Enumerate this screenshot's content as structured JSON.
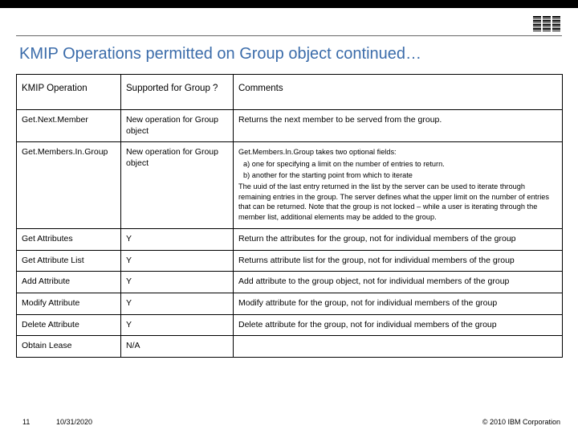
{
  "header": {
    "title": "KMIP Operations permitted on Group object continued…",
    "logo_alt": "IBM"
  },
  "table": {
    "headers": [
      "KMIP Operation",
      "Supported for Group ?",
      "Comments"
    ],
    "rows": [
      {
        "op": "Get.Next.Member",
        "sup": "New operation for Group object",
        "comment_plain": "Returns the next member to be served from the group."
      },
      {
        "op": "Get.Members.In.Group",
        "sup": "New operation for Group object",
        "comment_lines": [
          "Get.Members.In.Group takes two optional fields:",
          "a) one for specifying a limit on the number of entries to return.",
          "b) another for the starting point from which to iterate",
          "The uuid of the last entry returned in the list by the server can be used to iterate through remaining entries in the group.  The server defines what the upper limit on the number of entries that can be returned. Note that the group is not locked – while a user is iterating through the member list, additional elements may be added to the group."
        ]
      },
      {
        "op": "Get Attributes",
        "sup": "Y",
        "comment_plain": "Return the attributes for the group, not for individual members of the group"
      },
      {
        "op": "Get Attribute List",
        "sup": "Y",
        "comment_plain": "Returns attribute list for the group, not for individual members of the group"
      },
      {
        "op": "Add Attribute",
        "sup": "Y",
        "comment_plain": "Add attribute to the group object, not for individual members of the group"
      },
      {
        "op": "Modify Attribute",
        "sup": "Y",
        "comment_plain": "Modify attribute for the group, not for individual members of the group"
      },
      {
        "op": "Delete Attribute",
        "sup": "Y",
        "comment_plain": "Delete attribute for the group, not for individual members of the group"
      },
      {
        "op": "Obtain Lease",
        "sup": "N/A",
        "comment_plain": ""
      }
    ]
  },
  "footer": {
    "page": "11",
    "date": "10/31/2020",
    "copyright": "© 2010 IBM Corporation"
  }
}
